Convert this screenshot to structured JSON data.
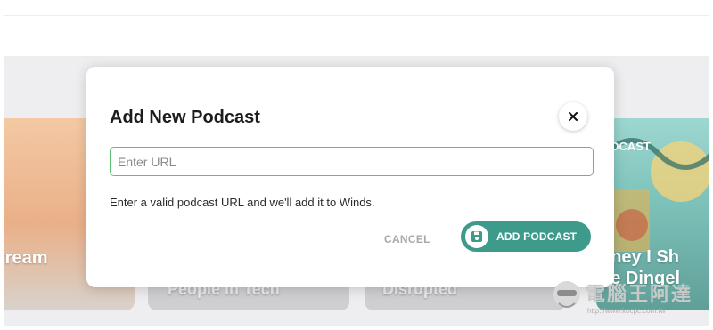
{
  "background": {
    "cards": [
      {
        "title": "tream"
      },
      {
        "title": "People in Tech"
      },
      {
        "title": "Disrupted"
      },
      {
        "badge": "ODCAST",
        "title": "oney I Sh",
        "title2": "he Dingel"
      }
    ]
  },
  "modal": {
    "title": "Add New Podcast",
    "close_icon": "close-icon",
    "url_input": {
      "value": "",
      "placeholder": "Enter URL"
    },
    "helper_text": "Enter a valid podcast URL and we'll add it to Winds.",
    "cancel_label": "CANCEL",
    "add_label": "ADD PODCAST",
    "add_icon": "save-icon"
  },
  "watermark": {
    "text": "電腦王阿達",
    "url": "http://www.kocpc.com.tw"
  },
  "colors": {
    "accent": "#3e9b8c",
    "input_border": "#5fbf72",
    "cancel_text": "#a8a8a8",
    "title_text": "#1c1c1c"
  }
}
